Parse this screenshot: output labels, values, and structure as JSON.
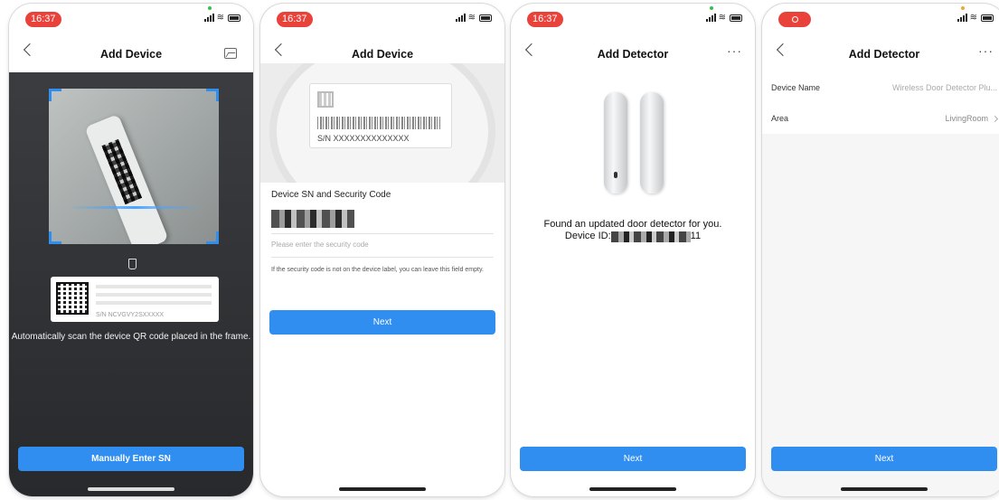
{
  "screen1": {
    "time": "16:37",
    "title": "Add Device",
    "hint": "Automatically scan the device QR code placed in the frame.",
    "label_sn": "S/N  NCVGVY2SXXXXX",
    "button": "Manually Enter SN"
  },
  "screen2": {
    "time": "16:37",
    "title": "Add Device",
    "sn_text": "S/N  XXXXXXXXXXXXXX",
    "field_title": "Device SN and Security Code",
    "placeholder": "Please enter the security code",
    "note": "If the security code is not on the device label, you can leave this field empty.",
    "button": "Next"
  },
  "screen3": {
    "time": "16:37",
    "title": "Add Detector",
    "more": "···",
    "found_line1": "Found an updated door detector for you.",
    "device_id_prefix": "Device ID:",
    "device_id_suffix": "11",
    "button": "Next"
  },
  "screen4": {
    "title": "Add Detector",
    "more": "···",
    "rows": [
      {
        "label": "Device Name",
        "value": "Wireless Door Detector Plu..."
      },
      {
        "label": "Area",
        "value": "LivingRoom"
      }
    ],
    "button": "Next"
  },
  "colors": {
    "accent": "#2f8ef0",
    "time_pill": "#e8423a"
  }
}
